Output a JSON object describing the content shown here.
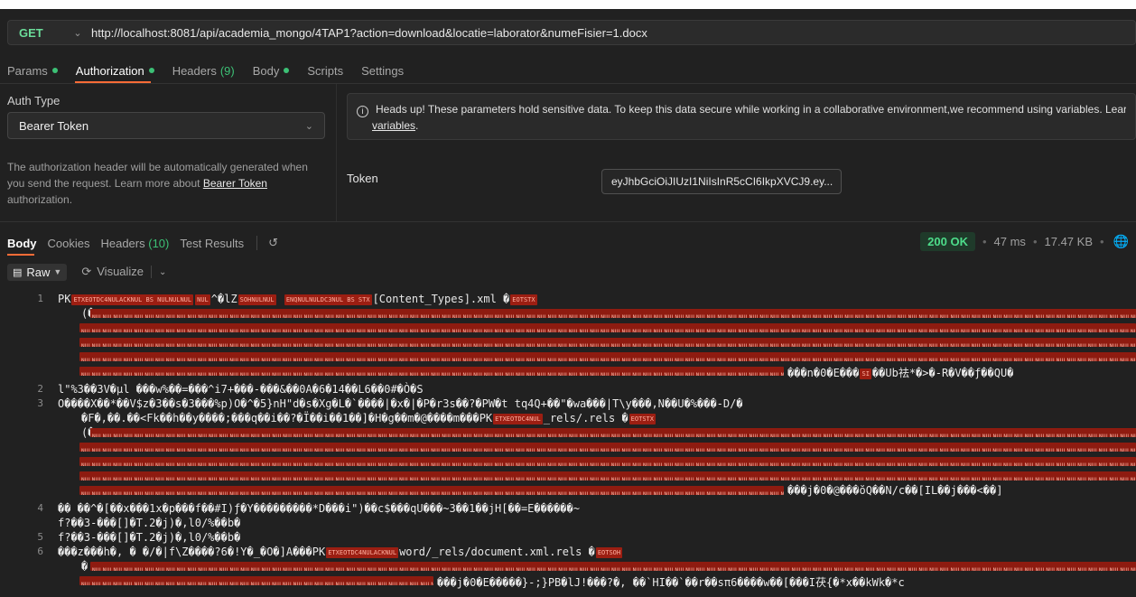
{
  "request": {
    "method": "GET",
    "url": "http://localhost:8081/api/academia_mongo/4TAP1?action=download&locatie=laborator&numeFisier=1.docx"
  },
  "request_tabs": [
    {
      "label": "Params",
      "dot": true
    },
    {
      "label": "Authorization",
      "dot": true,
      "active": true
    },
    {
      "label": "Headers",
      "count": "(9)"
    },
    {
      "label": "Body",
      "dot": true
    },
    {
      "label": "Scripts"
    },
    {
      "label": "Settings"
    }
  ],
  "auth": {
    "type_label": "Auth Type",
    "type_value": "Bearer Token",
    "description_pre": "The authorization header will be automatically generated when you send the request. Learn more about ",
    "description_link": "Bearer Token",
    "description_post": " authorization.",
    "notice_text": "Heads up! These parameters hold sensitive data. To keep this data secure while working in a collaborative environment,we recommend using variables. Learn",
    "notice_link": "variables",
    "notice_end": ".",
    "token_label": "Token",
    "token_value": "eyJhbGciOiJIUzI1NiIsInR5cCI6IkpXVCJ9.ey..."
  },
  "response_tabs": [
    {
      "label": "Body",
      "active": true
    },
    {
      "label": "Cookies"
    },
    {
      "label": "Headers",
      "count": "(10)"
    },
    {
      "label": "Test Results"
    }
  ],
  "response": {
    "status": "200 OK",
    "time": "47 ms",
    "size": "17.47 KB"
  },
  "toolbar": {
    "format": "Raw",
    "visualize": "Visualize"
  },
  "code_lines": [
    {
      "n": "1",
      "text": "PK"
    },
    {
      "n": "2",
      "text": "l\"%3��3V�µl   ���w%��=���^i7+���-���&��0A�6�14��L6��0#�Ò�S"
    },
    {
      "n": "3",
      "text": "O����X��*��V$z�3��s�3���%p)O�^�5}nH\"d�s�Xg�L�`����|�x�|�P�r3s��?�PW�t tq4Q+��\"�wa���|T\\y���,N��U�%���-D/�"
    },
    {
      "n": "4",
      "text": "��  ��^�[��x���1x�p���f��#I)ƒ�Y���������*D���i\")��c$���qU���~3��1��jH[��=E������~"
    },
    {
      "n": "5",
      "text": "f?��3-���[]�T.2�j)�,l0/%��b�"
    },
    {
      "n": "6",
      "text": "���z���h�, �  �/�|f\\Z����?6�!Y�_�O�]A���PK"
    },
    {
      "n": "",
      "text": "�"
    }
  ],
  "code_fragments": {
    "line1_tail": "[Content_Types].xml",
    "line3b": "�F�,��.��<Fk��h��y����;���q��i��?�Ï��i��1��]�H�g��m�@����m���PK",
    "line3b_tail": "_rels/.rels",
    "line6_tail": "word/_rels/document.xml.rels"
  }
}
